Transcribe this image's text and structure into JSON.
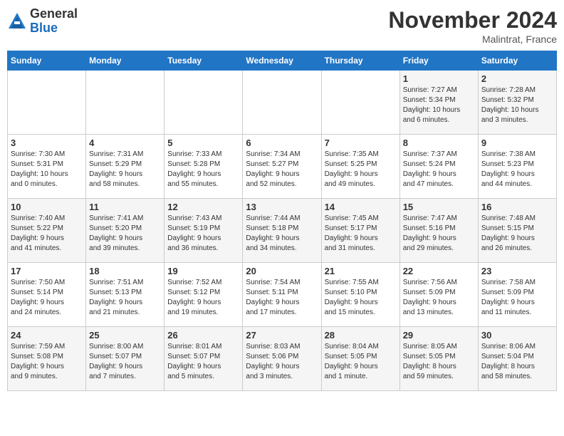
{
  "header": {
    "logo_general": "General",
    "logo_blue": "Blue",
    "month_title": "November 2024",
    "location": "Malintrat, France"
  },
  "days_of_week": [
    "Sunday",
    "Monday",
    "Tuesday",
    "Wednesday",
    "Thursday",
    "Friday",
    "Saturday"
  ],
  "weeks": [
    [
      {
        "day": "",
        "info": ""
      },
      {
        "day": "",
        "info": ""
      },
      {
        "day": "",
        "info": ""
      },
      {
        "day": "",
        "info": ""
      },
      {
        "day": "",
        "info": ""
      },
      {
        "day": "1",
        "info": "Sunrise: 7:27 AM\nSunset: 5:34 PM\nDaylight: 10 hours\nand 6 minutes."
      },
      {
        "day": "2",
        "info": "Sunrise: 7:28 AM\nSunset: 5:32 PM\nDaylight: 10 hours\nand 3 minutes."
      }
    ],
    [
      {
        "day": "3",
        "info": "Sunrise: 7:30 AM\nSunset: 5:31 PM\nDaylight: 10 hours\nand 0 minutes."
      },
      {
        "day": "4",
        "info": "Sunrise: 7:31 AM\nSunset: 5:29 PM\nDaylight: 9 hours\nand 58 minutes."
      },
      {
        "day": "5",
        "info": "Sunrise: 7:33 AM\nSunset: 5:28 PM\nDaylight: 9 hours\nand 55 minutes."
      },
      {
        "day": "6",
        "info": "Sunrise: 7:34 AM\nSunset: 5:27 PM\nDaylight: 9 hours\nand 52 minutes."
      },
      {
        "day": "7",
        "info": "Sunrise: 7:35 AM\nSunset: 5:25 PM\nDaylight: 9 hours\nand 49 minutes."
      },
      {
        "day": "8",
        "info": "Sunrise: 7:37 AM\nSunset: 5:24 PM\nDaylight: 9 hours\nand 47 minutes."
      },
      {
        "day": "9",
        "info": "Sunrise: 7:38 AM\nSunset: 5:23 PM\nDaylight: 9 hours\nand 44 minutes."
      }
    ],
    [
      {
        "day": "10",
        "info": "Sunrise: 7:40 AM\nSunset: 5:22 PM\nDaylight: 9 hours\nand 41 minutes."
      },
      {
        "day": "11",
        "info": "Sunrise: 7:41 AM\nSunset: 5:20 PM\nDaylight: 9 hours\nand 39 minutes."
      },
      {
        "day": "12",
        "info": "Sunrise: 7:43 AM\nSunset: 5:19 PM\nDaylight: 9 hours\nand 36 minutes."
      },
      {
        "day": "13",
        "info": "Sunrise: 7:44 AM\nSunset: 5:18 PM\nDaylight: 9 hours\nand 34 minutes."
      },
      {
        "day": "14",
        "info": "Sunrise: 7:45 AM\nSunset: 5:17 PM\nDaylight: 9 hours\nand 31 minutes."
      },
      {
        "day": "15",
        "info": "Sunrise: 7:47 AM\nSunset: 5:16 PM\nDaylight: 9 hours\nand 29 minutes."
      },
      {
        "day": "16",
        "info": "Sunrise: 7:48 AM\nSunset: 5:15 PM\nDaylight: 9 hours\nand 26 minutes."
      }
    ],
    [
      {
        "day": "17",
        "info": "Sunrise: 7:50 AM\nSunset: 5:14 PM\nDaylight: 9 hours\nand 24 minutes."
      },
      {
        "day": "18",
        "info": "Sunrise: 7:51 AM\nSunset: 5:13 PM\nDaylight: 9 hours\nand 21 minutes."
      },
      {
        "day": "19",
        "info": "Sunrise: 7:52 AM\nSunset: 5:12 PM\nDaylight: 9 hours\nand 19 minutes."
      },
      {
        "day": "20",
        "info": "Sunrise: 7:54 AM\nSunset: 5:11 PM\nDaylight: 9 hours\nand 17 minutes."
      },
      {
        "day": "21",
        "info": "Sunrise: 7:55 AM\nSunset: 5:10 PM\nDaylight: 9 hours\nand 15 minutes."
      },
      {
        "day": "22",
        "info": "Sunrise: 7:56 AM\nSunset: 5:09 PM\nDaylight: 9 hours\nand 13 minutes."
      },
      {
        "day": "23",
        "info": "Sunrise: 7:58 AM\nSunset: 5:09 PM\nDaylight: 9 hours\nand 11 minutes."
      }
    ],
    [
      {
        "day": "24",
        "info": "Sunrise: 7:59 AM\nSunset: 5:08 PM\nDaylight: 9 hours\nand 9 minutes."
      },
      {
        "day": "25",
        "info": "Sunrise: 8:00 AM\nSunset: 5:07 PM\nDaylight: 9 hours\nand 7 minutes."
      },
      {
        "day": "26",
        "info": "Sunrise: 8:01 AM\nSunset: 5:07 PM\nDaylight: 9 hours\nand 5 minutes."
      },
      {
        "day": "27",
        "info": "Sunrise: 8:03 AM\nSunset: 5:06 PM\nDaylight: 9 hours\nand 3 minutes."
      },
      {
        "day": "28",
        "info": "Sunrise: 8:04 AM\nSunset: 5:05 PM\nDaylight: 9 hours\nand 1 minute."
      },
      {
        "day": "29",
        "info": "Sunrise: 8:05 AM\nSunset: 5:05 PM\nDaylight: 8 hours\nand 59 minutes."
      },
      {
        "day": "30",
        "info": "Sunrise: 8:06 AM\nSunset: 5:04 PM\nDaylight: 8 hours\nand 58 minutes."
      }
    ]
  ]
}
